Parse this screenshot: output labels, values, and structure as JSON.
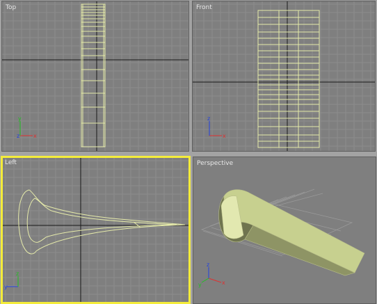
{
  "viewports": {
    "top": {
      "label": "Top"
    },
    "front": {
      "label": "Front"
    },
    "left": {
      "label": "Left"
    },
    "perspective": {
      "label": "Perspective"
    }
  },
  "active_viewport": "left",
  "colors": {
    "viewport_background": "#7f7f7f",
    "grid_line": "#8c8c8c",
    "grid_major": "#1a1a1a",
    "wireframe": "#e6ebaa",
    "active_border": "#f4ec3a",
    "axis_x": "#e03030",
    "axis_y": "#20c020",
    "axis_z": "#2040e0"
  },
  "axis_labels": {
    "x": "x",
    "y": "y",
    "z": "z"
  }
}
